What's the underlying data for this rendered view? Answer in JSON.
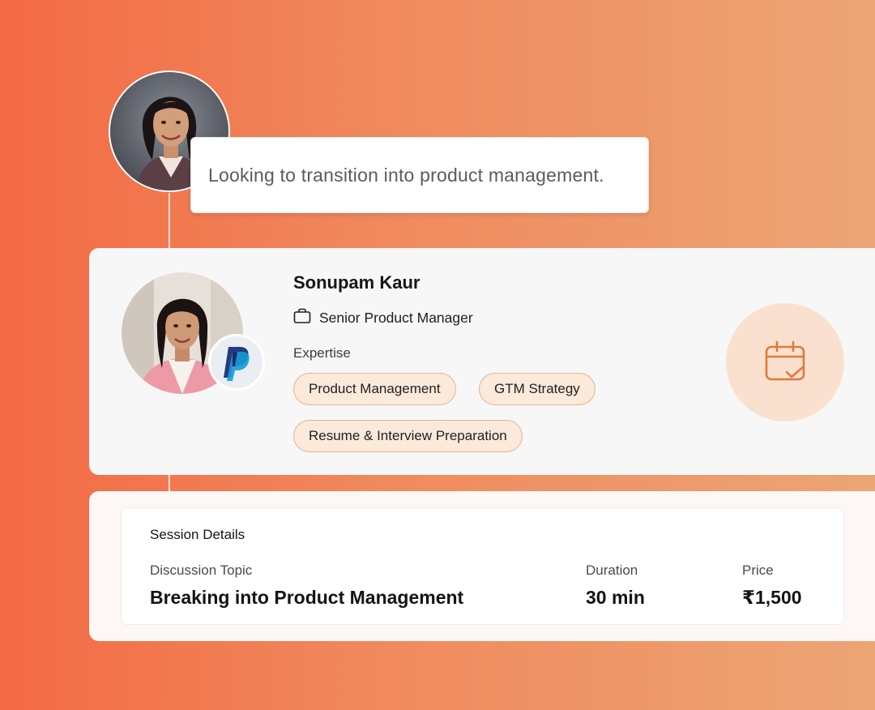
{
  "seeker": {
    "message": "Looking to transition into product management."
  },
  "mentor": {
    "name": "Sonupam Kaur",
    "role": "Senior Product Manager",
    "expertise_label": "Expertise",
    "expertise": [
      "Product Management",
      "GTM Strategy",
      "Resume & Interview Preparation"
    ],
    "company_logo": "paypal-logo",
    "action_icon": "calendar-check-icon"
  },
  "session": {
    "heading": "Session Details",
    "topic_label": "Discussion Topic",
    "topic_value": "Breaking into Product Management",
    "duration_label": "Duration",
    "duration_value": "30 min",
    "price_label": "Price",
    "price_value": "₹1,500"
  },
  "colors": {
    "background_gradient_start": "#f36a44",
    "background_gradient_end": "#eca575",
    "chip_fill": "#fbe9da",
    "chip_border": "#e9b38f",
    "calendar_bg": "#fae1cf",
    "calendar_icon": "#e07a3c"
  }
}
